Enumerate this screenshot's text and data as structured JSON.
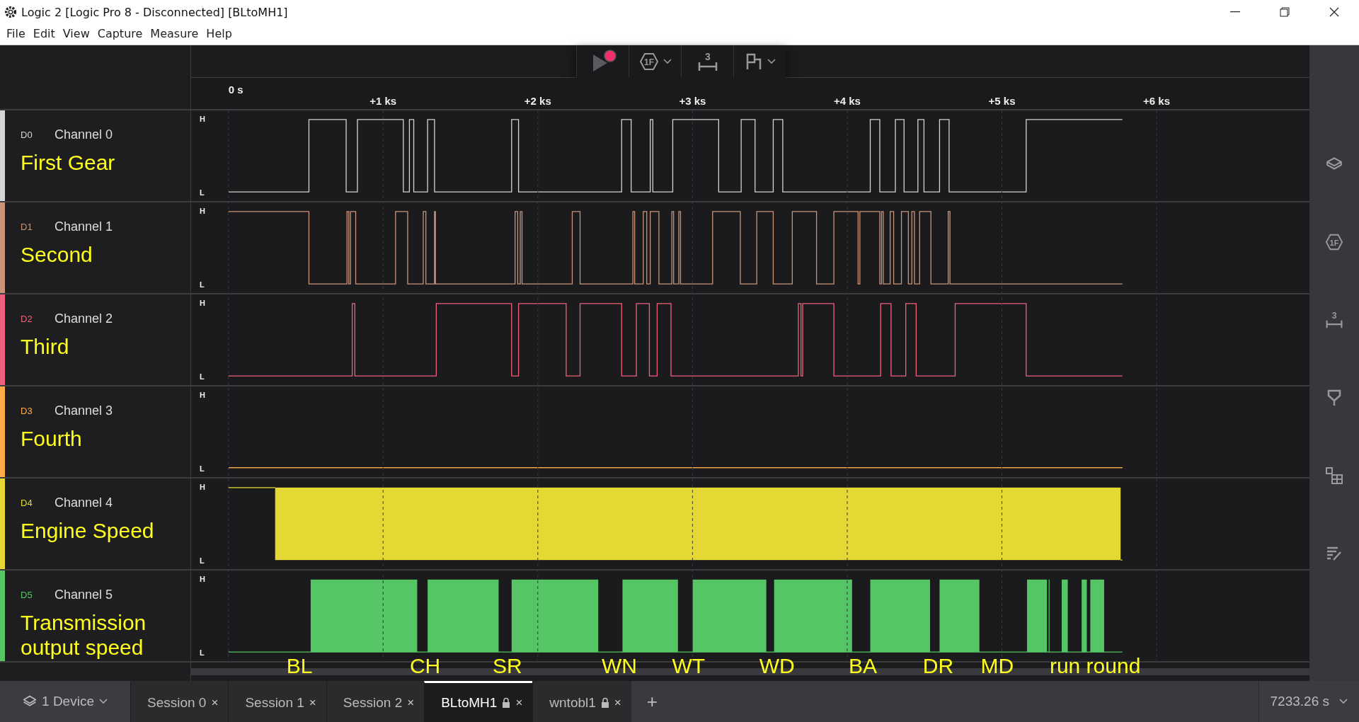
{
  "window": {
    "title": "Logic 2 [Logic Pro 8 - Disconnected] [BLtoMH1]"
  },
  "menu": [
    "File",
    "Edit",
    "View",
    "Capture",
    "Measure",
    "Help"
  ],
  "toolbar": {
    "trigger_glyph": "1F",
    "measure_glyph": "3"
  },
  "ruler": {
    "ticks": [
      "0 s",
      "+1 ks",
      "+2 ks",
      "+3 ks",
      "+4 ks",
      "+5 ks",
      "+6 ks"
    ]
  },
  "channels": [
    {
      "id": "D0",
      "name": "Channel 0",
      "label": "First Gear",
      "color": "#d4d4d4",
      "high": "H",
      "low": "L"
    },
    {
      "id": "D1",
      "name": "Channel 1",
      "label": "Second",
      "color": "#c8957a",
      "high": "H",
      "low": "L"
    },
    {
      "id": "D2",
      "name": "Channel 2",
      "label": "Third",
      "color": "#f0607a",
      "high": "H",
      "low": "L"
    },
    {
      "id": "D3",
      "name": "Channel 3",
      "label": "Fourth",
      "color": "#ffab4a",
      "high": "H",
      "low": "L"
    },
    {
      "id": "D4",
      "name": "Channel 4",
      "label": "Engine Speed",
      "color": "#e5d835",
      "high": "H",
      "low": "L"
    },
    {
      "id": "D5",
      "name": "Channel 5",
      "label": "Transmission output speed",
      "color": "#55c566",
      "high": "H",
      "low": "L"
    }
  ],
  "annotations": [
    "BL",
    "CH",
    "SR",
    "WN",
    "WT",
    "WD",
    "BA",
    "DR",
    "MD",
    "run round"
  ],
  "sidebar": {
    "trigger_glyph": "1F",
    "measure_glyph": "3"
  },
  "device": {
    "label": "1 Device"
  },
  "tabs": [
    {
      "label": "Session 0",
      "selected": false,
      "locked": false,
      "close": "×"
    },
    {
      "label": "Session 1",
      "selected": false,
      "locked": false,
      "close": "×"
    },
    {
      "label": "Session 2",
      "selected": false,
      "locked": false,
      "close": "×"
    },
    {
      "label": "BLtoMH1",
      "selected": true,
      "locked": true,
      "close": "×"
    },
    {
      "label": "wntobl1",
      "selected": false,
      "locked": true,
      "close": "×"
    }
  ],
  "add_tab": "+",
  "duration": "7233.26 s"
}
